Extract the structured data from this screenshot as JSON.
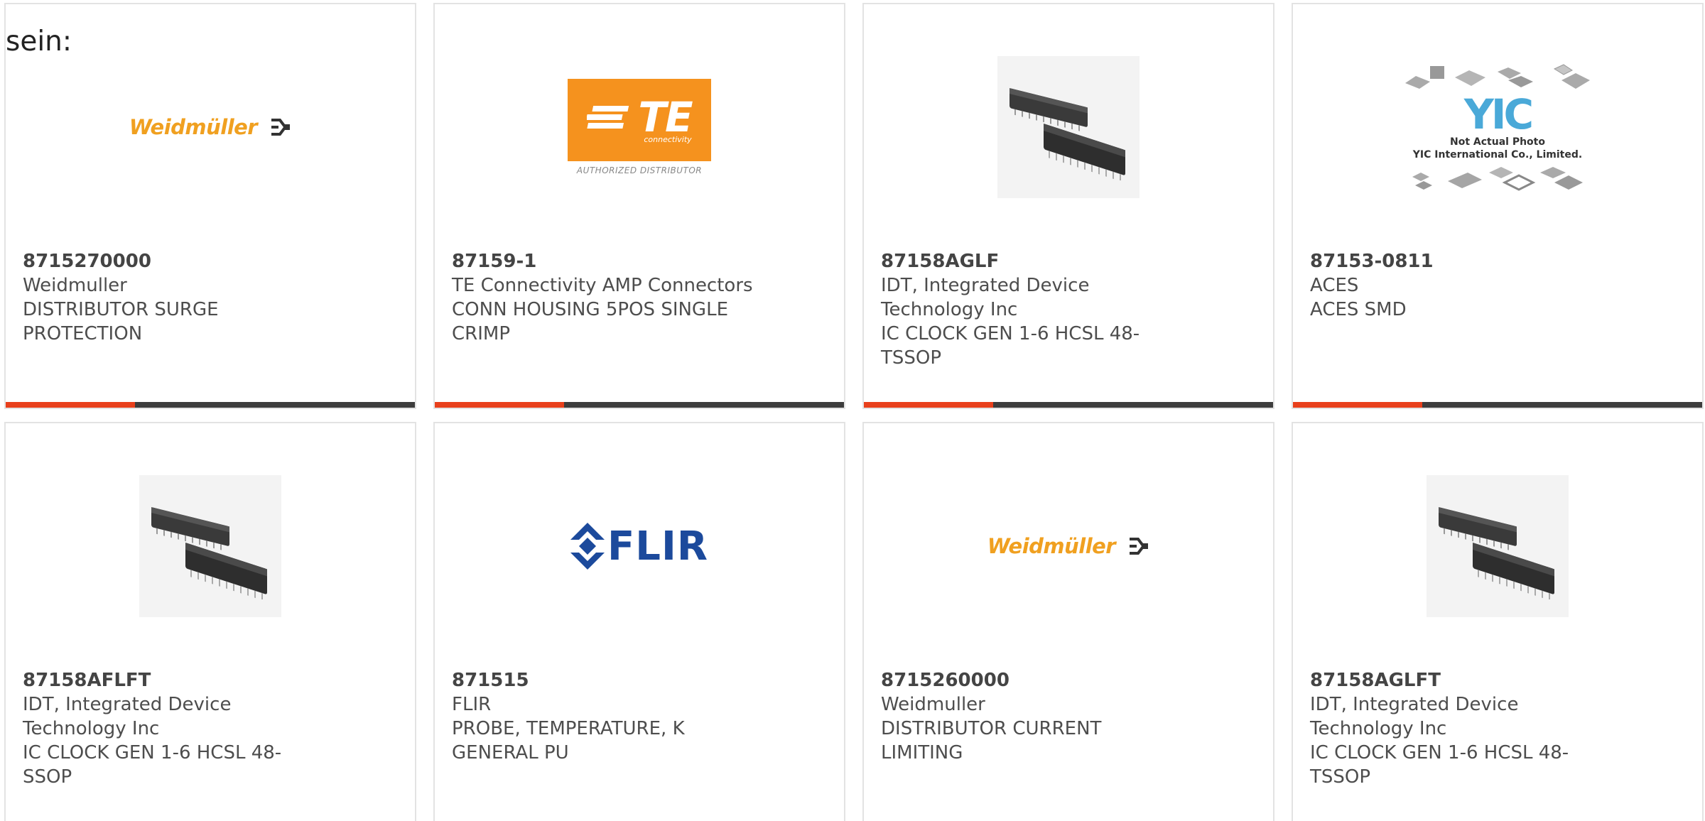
{
  "heading": "sein:",
  "colors": {
    "accent": "#e8401c",
    "bar": "#3d3d3d",
    "weidmuller": "#f0a020",
    "te_orange": "#f5921e",
    "flir_blue": "#1c4a9c"
  },
  "products": [
    {
      "part": "8715270000",
      "manufacturer": "Weidmuller",
      "desc1": "DISTRIBUTOR SURGE",
      "desc2": "PROTECTION",
      "desc3": "",
      "logo": "weidmuller-logo"
    },
    {
      "part": "87159-1",
      "manufacturer": "TE Connectivity AMP Connectors",
      "desc1": "CONN HOUSING 5POS SINGLE",
      "desc2": "CRIMP",
      "desc3": "",
      "logo": "te-logo",
      "te_text": "TE",
      "te_sub": "connectivity",
      "te_auth": "AUTHORIZED DISTRIBUTOR"
    },
    {
      "part": "87158AGLF",
      "manufacturer": "IDT, Integrated Device",
      "desc1": "Technology Inc",
      "desc2": "IC CLOCK GEN 1-6 HCSL 48-",
      "desc3": "TSSOP",
      "logo": "chip-photo"
    },
    {
      "part": "87153-0811",
      "manufacturer": "ACES",
      "desc1": "ACES SMD",
      "desc2": "",
      "desc3": "",
      "logo": "yic-placeholder",
      "yic_line1": "Not Actual Photo",
      "yic_line2": "YIC International Co., Limited."
    },
    {
      "part": "87158AFLFT",
      "manufacturer": "IDT, Integrated Device",
      "desc1": "Technology Inc",
      "desc2": "IC CLOCK GEN 1-6 HCSL 48-SSOP",
      "desc3": "",
      "logo": "chip-photo"
    },
    {
      "part": "871515",
      "manufacturer": "FLIR",
      "desc1": "PROBE, TEMPERATURE, K",
      "desc2": "GENERAL PU",
      "desc3": "",
      "logo": "flir-logo",
      "flir_text": "FLIR"
    },
    {
      "part": "8715260000",
      "manufacturer": "Weidmuller",
      "desc1": "DISTRIBUTOR CURRENT",
      "desc2": "LIMITING",
      "desc3": "",
      "logo": "weidmuller-logo"
    },
    {
      "part": "87158AGLFT",
      "manufacturer": "IDT, Integrated Device",
      "desc1": "Technology Inc",
      "desc2": "IC CLOCK GEN 1-6 HCSL 48-",
      "desc3": "TSSOP",
      "logo": "chip-photo"
    }
  ],
  "weidmuller_text": "Weidmüller"
}
